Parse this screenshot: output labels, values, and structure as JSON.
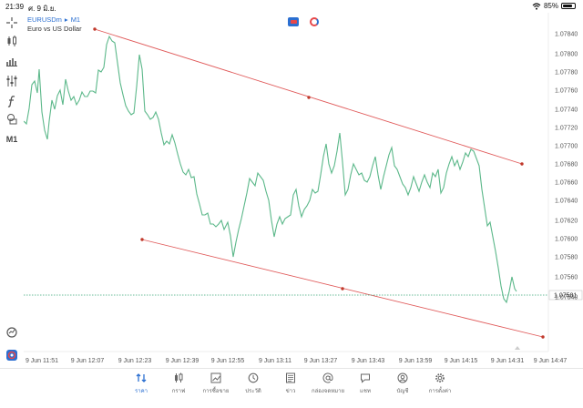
{
  "status_bar": {
    "time": "21:39",
    "date": "ศ. 9 มิ.ย.",
    "battery": "85%"
  },
  "symbol": {
    "name": "EURUSDm",
    "timeframe": "M1",
    "description": "Euro vs US Dollar"
  },
  "left_toolbar": {
    "timeframe_label": "M1"
  },
  "price_axis": {
    "labels": [
      "1.07840",
      "1.07800",
      "1.07780",
      "1.07760",
      "1.07740",
      "1.07720",
      "1.07700",
      "1.07680",
      "1.07660",
      "1.07640",
      "1.07620",
      "1.07600",
      "1.07580",
      "1.07560",
      "1.07540"
    ],
    "current_price": "1.07581"
  },
  "time_axis": {
    "labels": [
      "9 Jun 11:51",
      "9 Jun 12:07",
      "9 Jun 12:23",
      "9 Jun 12:39",
      "9 Jun 12:55",
      "9 Jun 13:11",
      "9 Jun 13:27",
      "9 Jun 13:43",
      "9 Jun 13:59",
      "9 Jun 14:15",
      "9 Jun 14:31",
      "9 Jun 14:47"
    ]
  },
  "colors": {
    "price_line": "#5cb88a",
    "trend_line": "#e05a5a",
    "accent": "#2b6fd1",
    "current_price_line": "#3aa67a"
  },
  "bottom_tabs": [
    {
      "label": "ราคา",
      "icon": "quotes-icon",
      "active": true
    },
    {
      "label": "กราฟ",
      "icon": "chart-icon",
      "active": false
    },
    {
      "label": "การซื้อขาย",
      "icon": "trade-icon",
      "active": false
    },
    {
      "label": "ประวัติ",
      "icon": "history-icon",
      "active": false
    },
    {
      "label": "ข่าว",
      "icon": "news-icon",
      "active": false
    },
    {
      "label": "กล่องจดหมาย",
      "icon": "mailbox-icon",
      "active": false
    },
    {
      "label": "แชท",
      "icon": "chat-icon",
      "active": false
    },
    {
      "label": "บัญชี",
      "icon": "account-icon",
      "active": false
    },
    {
      "label": "การตั้งค่า",
      "icon": "settings-icon",
      "active": false
    }
  ]
}
